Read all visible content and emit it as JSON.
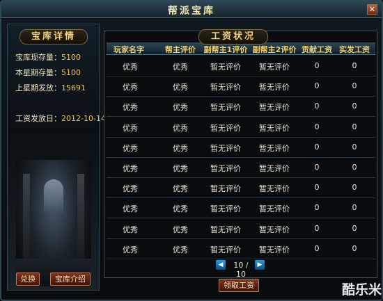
{
  "window": {
    "title": "帮派宝库",
    "close_icon": "close-icon"
  },
  "left_panel": {
    "banner": "宝库详情",
    "stats": [
      {
        "label": "宝库现存量：",
        "value": "5100"
      },
      {
        "label": "本星期存量：",
        "value": "5100"
      },
      {
        "label": "上星期发放：",
        "value": "15691"
      }
    ],
    "payday": {
      "label": "工资发放日：",
      "value": "2012-10-14"
    },
    "buttons": {
      "exchange": "兑换",
      "intro": "宝库介绍"
    }
  },
  "right_panel": {
    "banner": "工资状况",
    "columns": [
      "玩家名字",
      "帮主评价",
      "副帮主1评价",
      "副帮主2评价",
      "贡献工资",
      "实发工资"
    ],
    "rows": [
      [
        "",
        "优秀",
        "优秀",
        "暂无评价",
        "暂无评价",
        "0",
        "0"
      ],
      [
        "",
        "优秀",
        "优秀",
        "暂无评价",
        "暂无评价",
        "0",
        "0"
      ],
      [
        "",
        "优秀",
        "优秀",
        "暂无评价",
        "暂无评价",
        "0",
        "0"
      ],
      [
        "",
        "优秀",
        "优秀",
        "暂无评价",
        "暂无评价",
        "0",
        "0"
      ],
      [
        "",
        "优秀",
        "优秀",
        "暂无评价",
        "暂无评价",
        "0",
        "0"
      ],
      [
        "",
        "优秀",
        "优秀",
        "暂无评价",
        "暂无评价",
        "0",
        "0"
      ],
      [
        "",
        "优秀",
        "优秀",
        "暂无评价",
        "暂无评价",
        "0",
        "0"
      ],
      [
        "",
        "优秀",
        "优秀",
        "暂无评价",
        "暂无评价",
        "0",
        "0"
      ],
      [
        "",
        "优秀",
        "优秀",
        "暂无评价",
        "暂无评价",
        "0",
        "0"
      ],
      [
        "",
        "优秀",
        "优秀",
        "暂无评价",
        "暂无评价",
        "0",
        "0"
      ]
    ],
    "pager": {
      "text": "10 / 10",
      "prev_icon": "arrow-left-icon",
      "next_icon": "arrow-right-icon"
    },
    "collect_button": "领取工资"
  },
  "watermark": "酷乐米",
  "colors": {
    "accent_gold": "#f5c74a",
    "header_gold": "#f0cf72",
    "button_red": "#7d3520"
  }
}
